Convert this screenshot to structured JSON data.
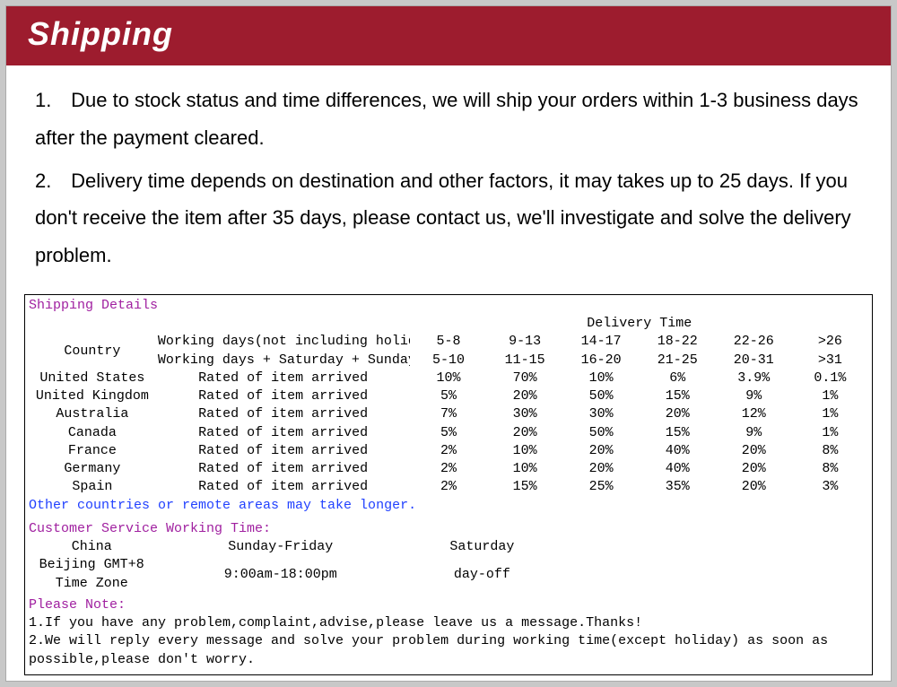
{
  "header": {
    "title": "Shipping"
  },
  "paragraphs": {
    "p1_num": "1.",
    "p1": "Due to stock status and time differences, we will ship your orders within 1-3 business days after the payment cleared.",
    "p2_num": "2.",
    "p2": "Delivery time depends on destination and other factors, it may takes up to 25 days. If you don't receive the item after 35 days, please contact us, we'll investigate and solve the delivery problem."
  },
  "details": {
    "title": "Shipping Details",
    "delivery_time_header": "Delivery Time",
    "col_country": "Country",
    "row_wd": "Working days(not including holiday)",
    "row_wdss": "Working days + Saturday + Sunday",
    "cols_wd": [
      "5-8",
      "9-13",
      "14-17",
      "18-22",
      "22-26",
      ">26"
    ],
    "cols_wdss": [
      "5-10",
      "11-15",
      "16-20",
      "21-25",
      "20-31",
      ">31"
    ],
    "rated_label": "Rated of item arrived",
    "rows": [
      {
        "country": "United States",
        "vals": [
          "10%",
          "70%",
          "10%",
          "6%",
          "3.9%",
          "0.1%"
        ]
      },
      {
        "country": "United Kingdom",
        "vals": [
          "5%",
          "20%",
          "50%",
          "15%",
          "9%",
          "1%"
        ]
      },
      {
        "country": "Australia",
        "vals": [
          "7%",
          "30%",
          "30%",
          "20%",
          "12%",
          "1%"
        ]
      },
      {
        "country": "Canada",
        "vals": [
          "5%",
          "20%",
          "50%",
          "15%",
          "9%",
          "1%"
        ]
      },
      {
        "country": "France",
        "vals": [
          "2%",
          "10%",
          "20%",
          "40%",
          "20%",
          "8%"
        ]
      },
      {
        "country": "Germany",
        "vals": [
          "2%",
          "10%",
          "20%",
          "40%",
          "20%",
          "8%"
        ]
      },
      {
        "country": "Spain",
        "vals": [
          "2%",
          "15%",
          "25%",
          "35%",
          "20%",
          "3%"
        ]
      }
    ],
    "other_note": "Other countries or remote areas may take longer.",
    "cs_title": "Customer Service Working Time:",
    "cs": {
      "loc1": "China",
      "loc2": "Beijing GMT+8",
      "loc3": "Time Zone",
      "col1_header": "Sunday-Friday",
      "col1_val": "9:00am-18:00pm",
      "col2_header": "Saturday",
      "col2_val": "day-off"
    },
    "please_note_title": "Please Note:",
    "pn1": "1.If you have any problem,complaint,advise,please leave us a message.Thanks!",
    "pn2": "2.We will reply every message and solve your problem during working time(except holiday) as soon as possible,please don't worry."
  }
}
